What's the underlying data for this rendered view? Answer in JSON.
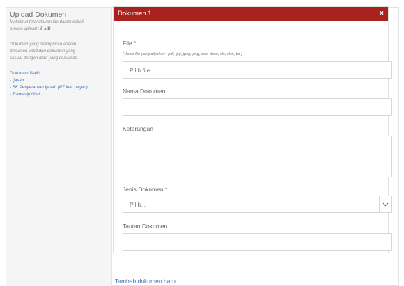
{
  "sidebar": {
    "title": "Upload Dokumen",
    "note_line1": "Maksimal total ukuran file dalam sekali",
    "note_line2_prefix": "proses upload : ",
    "note_line2_link": "5 MB",
    "info_line1": "Dokumen yang dilampirkan adalah",
    "info_line2": "dokumen valid dan dokumen yang",
    "info_line3": "sesuai dengan data yang diusulkan.",
    "required_title": "Dokumen Wajib :",
    "required_items": [
      "- Ijasah",
      "- SK Penyetaraan Ijasah (PT luar negeri)",
      "- Transkrip Nilai"
    ]
  },
  "panel": {
    "title": "Dokumen 1",
    "close_symbol": "×"
  },
  "form": {
    "file_label": "File *",
    "file_hint_prefix": "( Jenis file yang diijinkan : ",
    "file_hint_types": "pdf, jpg, jpeg, png, doc, docx, xls, xlsx, txt",
    "file_hint_suffix": " )",
    "file_placeholder": "Pilih file",
    "nama_label": "Nama Dokumen",
    "nama_value": "",
    "keterangan_label": "Keterangan",
    "keterangan_value": "",
    "jenis_label": "Jenis Dokumen *",
    "jenis_selected": "Pilih...",
    "tautan_label": "Tautan Dokumen",
    "tautan_value": ""
  },
  "actions": {
    "add_document": "Tambah dokumen baru..."
  }
}
